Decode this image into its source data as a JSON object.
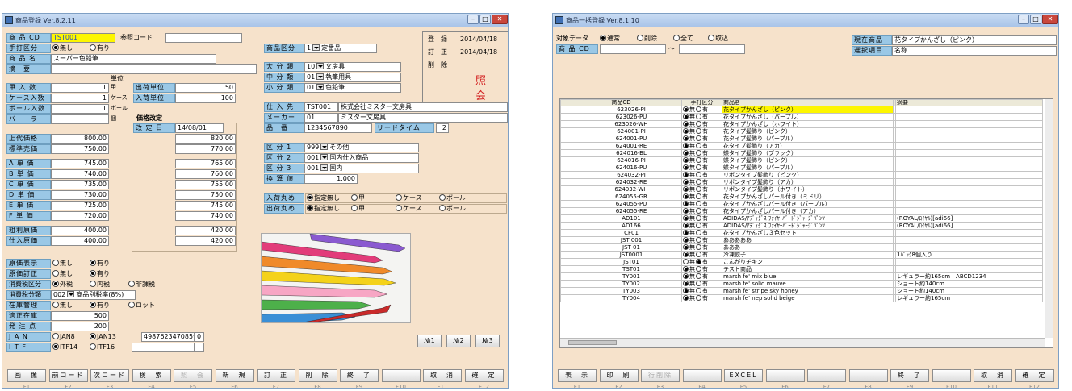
{
  "w1": {
    "title": "商品登録 Ver.8.2.11",
    "code_lbl": "商 品 CD",
    "code_val": "TST001",
    "ref_lbl": "参照コード",
    "manual_lbl": "手打区分",
    "none": "無し",
    "yes": "有り",
    "name_lbl": "商 品 名",
    "name_val": "スーパー色鉛筆",
    "memo_lbl": "摘　要",
    "unit_hdr": "単位",
    "qty_rows": [
      {
        "lbl": "甲 入 数",
        "v": "1",
        "u": "甲"
      },
      {
        "lbl": "ケース入数",
        "v": "1",
        "u": "ケース"
      },
      {
        "lbl": "ボール入数",
        "v": "1",
        "u": "ボール"
      },
      {
        "lbl": "バ　　ラ",
        "v": "",
        "u": "個"
      }
    ],
    "out_unit_lbl": "出荷単位",
    "out_unit_val": "50",
    "in_unit_lbl": "入荷単位",
    "in_unit_val": "100",
    "revise_hdr": "価格改定",
    "revise_date_lbl": "改 定 日",
    "revise_date": "14/08/01",
    "price_rows": [
      {
        "lbl": "上代価格",
        "v": "800.00",
        "n": "820.00"
      },
      {
        "lbl": "標準売価",
        "v": "750.00",
        "n": "770.00"
      },
      {
        "lbl": "A 単 価",
        "v": "745.00",
        "n": "765.00"
      },
      {
        "lbl": "B 単 価",
        "v": "740.00",
        "n": "760.00"
      },
      {
        "lbl": "C 単 価",
        "v": "735.00",
        "n": "755.00"
      },
      {
        "lbl": "D 単 価",
        "v": "730.00",
        "n": "750.00"
      },
      {
        "lbl": "E 単 価",
        "v": "725.00",
        "n": "745.00"
      },
      {
        "lbl": "F 単 価",
        "v": "720.00",
        "n": "740.00"
      },
      {
        "lbl": "粗利原価",
        "v": "400.00",
        "n": "420.00"
      },
      {
        "lbl": "仕入原価",
        "v": "400.00",
        "n": "420.00"
      }
    ],
    "cat_lbl": "商品区分",
    "cat_code": "1",
    "cat_val": "定番品",
    "reg_lbl": "登　録",
    "reg_date": "2014/04/18",
    "upd_lbl": "訂　正",
    "upd_date": "2014/04/18",
    "del_lbl": "削　除",
    "stamp": "照 会",
    "big_lbl": "大 分 類",
    "big_code": "10",
    "big_val": "文房具",
    "mid_lbl": "中 分 類",
    "mid_code": "01",
    "mid_val": "執筆用具",
    "small_lbl": "小 分 類",
    "small_code": "01",
    "small_val": "色鉛筆",
    "sup_lbl": "仕 入 先",
    "sup_code": "TST001",
    "sup_name": "株式会社ミスター文房具",
    "mkr_lbl": "メーカー",
    "mkr_code": "01",
    "mkr_name": "ミスター文房具",
    "pn_lbl": "品　番",
    "pn_val": "1234567890",
    "lead_lbl": "リードタイム",
    "lead_val": "2",
    "k1_lbl": "区 分 1",
    "k1_code": "999",
    "k1_val": "その他",
    "k2_lbl": "区 分 2",
    "k2_code": "001",
    "k2_val": "国内仕入商品",
    "k3_lbl": "区 分 3",
    "k3_code": "001",
    "k3_val": "国内",
    "conv_lbl": "換 算 値",
    "conv_val": "1.000",
    "in_round_lbl": "入荷丸め",
    "out_round_lbl": "出荷丸め",
    "r_none": "指定無し",
    "r_ko": "甲",
    "r_case": "ケース",
    "r_ball": "ボール",
    "cost_show_lbl": "原価表示",
    "cost_fix_lbl": "原価訂正",
    "tax_lbl": "消費税区分",
    "tax_out": "外税",
    "tax_in": "内税",
    "tax_non": "非課税",
    "tax_cls_lbl": "消費税分類",
    "tax_cls_code": "002",
    "tax_cls_val": "商品別税率(8%)",
    "stock_lbl": "在庫管理",
    "lot": "ロット",
    "safe_lbl": "適正在庫",
    "safe_val": "500",
    "order_lbl": "発 注 点",
    "order_val": "200",
    "jan_lbl": "J A N",
    "jan8": "JAN8",
    "jan13": "JAN13",
    "jan_code": "4987623470859",
    "jan_d": "0",
    "itf_lbl": "I T F",
    "itf14": "ITF14",
    "itf16": "ITF16",
    "no": [
      "№1",
      "№2",
      "№3"
    ],
    "buttons": [
      "画　像",
      "前コード",
      "次コード",
      "検　索",
      "照　会",
      "新　規",
      "訂　正",
      "削　除",
      "終　了",
      "",
      "取　消",
      "確　定"
    ],
    "fkeys": [
      "F1",
      "F2",
      "F3",
      "F4",
      "F5",
      "F6",
      "F7",
      "F8",
      "F9",
      "F10",
      "F11",
      "F12"
    ]
  },
  "w2": {
    "title": "商品一括登録 Ver.8.1.10",
    "target_lbl": "対象データ",
    "opt_normal": "通常",
    "opt_del": "削除",
    "opt_all": "全て",
    "opt_take": "取込",
    "code_lbl": "商 品 CD",
    "tilde": "～",
    "cur_lbl": "現在商品",
    "cur_val": "花タイプかんざし（ピンク）",
    "sel_lbl": "選択項目",
    "sel_val": "名称",
    "cols": [
      "商品CD",
      "手打区分",
      "商品名",
      "",
      "摘要"
    ],
    "mu": "無",
    "yu": "有",
    "rows": [
      {
        "cd": "623026-PI",
        "s": 0,
        "nm": "花タイプかんざし（ピンク）",
        "note": ""
      },
      {
        "cd": "623026-PU",
        "s": 0,
        "nm": "花タイプかんざし（パープル）",
        "note": ""
      },
      {
        "cd": "623026-WH",
        "s": 0,
        "nm": "花タイプかんざし（ホワイト）",
        "note": ""
      },
      {
        "cd": "624001-PI",
        "s": 0,
        "nm": "花タイプ髪飾り（ピンク）",
        "note": ""
      },
      {
        "cd": "624001-PU",
        "s": 0,
        "nm": "花タイプ髪飾り（パープル）",
        "note": ""
      },
      {
        "cd": "624001-RE",
        "s": 0,
        "nm": "花タイプ髪飾り（アカ）",
        "note": ""
      },
      {
        "cd": "624016-BL",
        "s": 0,
        "nm": "蝶タイプ髪飾り（ブラック）",
        "note": ""
      },
      {
        "cd": "624016-PI",
        "s": 0,
        "nm": "蝶タイプ髪飾り（ピンク）",
        "note": ""
      },
      {
        "cd": "624016-PU",
        "s": 0,
        "nm": "蝶タイプ髪飾り（パープル）",
        "note": ""
      },
      {
        "cd": "624032-PI",
        "s": 0,
        "nm": "リボンタイプ髪飾り（ピンク）",
        "note": ""
      },
      {
        "cd": "624032-RE",
        "s": 0,
        "nm": "リボンタイプ髪飾り（アカ）",
        "note": ""
      },
      {
        "cd": "624032-WH",
        "s": 0,
        "nm": "リボンタイプ髪飾り（ホワイト）",
        "note": ""
      },
      {
        "cd": "624055-GR",
        "s": 0,
        "nm": "花タイプかんざしパール付き（ミドリ）",
        "note": ""
      },
      {
        "cd": "624055-PU",
        "s": 0,
        "nm": "花タイプかんざしパール付き（パープル）",
        "note": ""
      },
      {
        "cd": "624055-RE",
        "s": 0,
        "nm": "花タイプかんざしパール付き（アカ）",
        "note": ""
      },
      {
        "cd": "AD101",
        "s": 0,
        "nm": "ADIDAS/ｱﾃﾞｨﾀﾞｽ ﾌｧｲﾔｰﾊﾞｰﾄﾞｼﾞｬｰｼﾞﾊﾟﾝﾂ",
        "note": "(ROYAL/ﾛｲﾔﾙ)[adi66]"
      },
      {
        "cd": "AD166",
        "s": 0,
        "nm": "ADIDAS/ｱﾃﾞｨﾀﾞｽ ﾌｧｲﾔｰﾊﾞｰﾄﾞｼﾞｬｰｼﾞﾊﾟﾝﾂ",
        "note": "(ROYAL/ﾛｲﾔﾙ)[adi66]"
      },
      {
        "cd": "CF01",
        "s": 0,
        "nm": "花タイプかんざし３色セット",
        "note": ""
      },
      {
        "cd": "JST 001",
        "s": 0,
        "nm": "あああああ",
        "note": ""
      },
      {
        "cd": "JST 01",
        "s": 0,
        "nm": "あああ",
        "note": ""
      },
      {
        "cd": "JST0001",
        "s": 0,
        "nm": "冷凍餃子",
        "note": "1ﾊﾟｯｸ8個入り"
      },
      {
        "cd": "JST01",
        "s": 1,
        "nm": "こんがりチキン",
        "note": ""
      },
      {
        "cd": "TST01",
        "s": 0,
        "nm": "テスト商品",
        "note": ""
      },
      {
        "cd": "TY001",
        "s": 0,
        "nm": "marsh fe' mix blue",
        "note": "レギュラー約165cm　ABCD1234"
      },
      {
        "cd": "TY002",
        "s": 0,
        "nm": "marsh fe' solid mauve",
        "note": "ショート約140cm"
      },
      {
        "cd": "TY003",
        "s": 0,
        "nm": "marsh fe' stripe sky honey",
        "note": "ショート約140cm"
      },
      {
        "cd": "TY004",
        "s": 0,
        "nm": "marsh fe' nep solid beige",
        "note": "レギュラー約165cm"
      }
    ],
    "buttons": [
      "表　示",
      "印　刷",
      "行削除",
      "",
      "EXCEL",
      "",
      "",
      "",
      "終　了",
      "",
      "取　消",
      "確　定"
    ],
    "fkeys": [
      "F1",
      "F2",
      "F3",
      "F4",
      "F5",
      "F6",
      "F7",
      "F8",
      "F9",
      "F10",
      "F11",
      "F12"
    ]
  }
}
